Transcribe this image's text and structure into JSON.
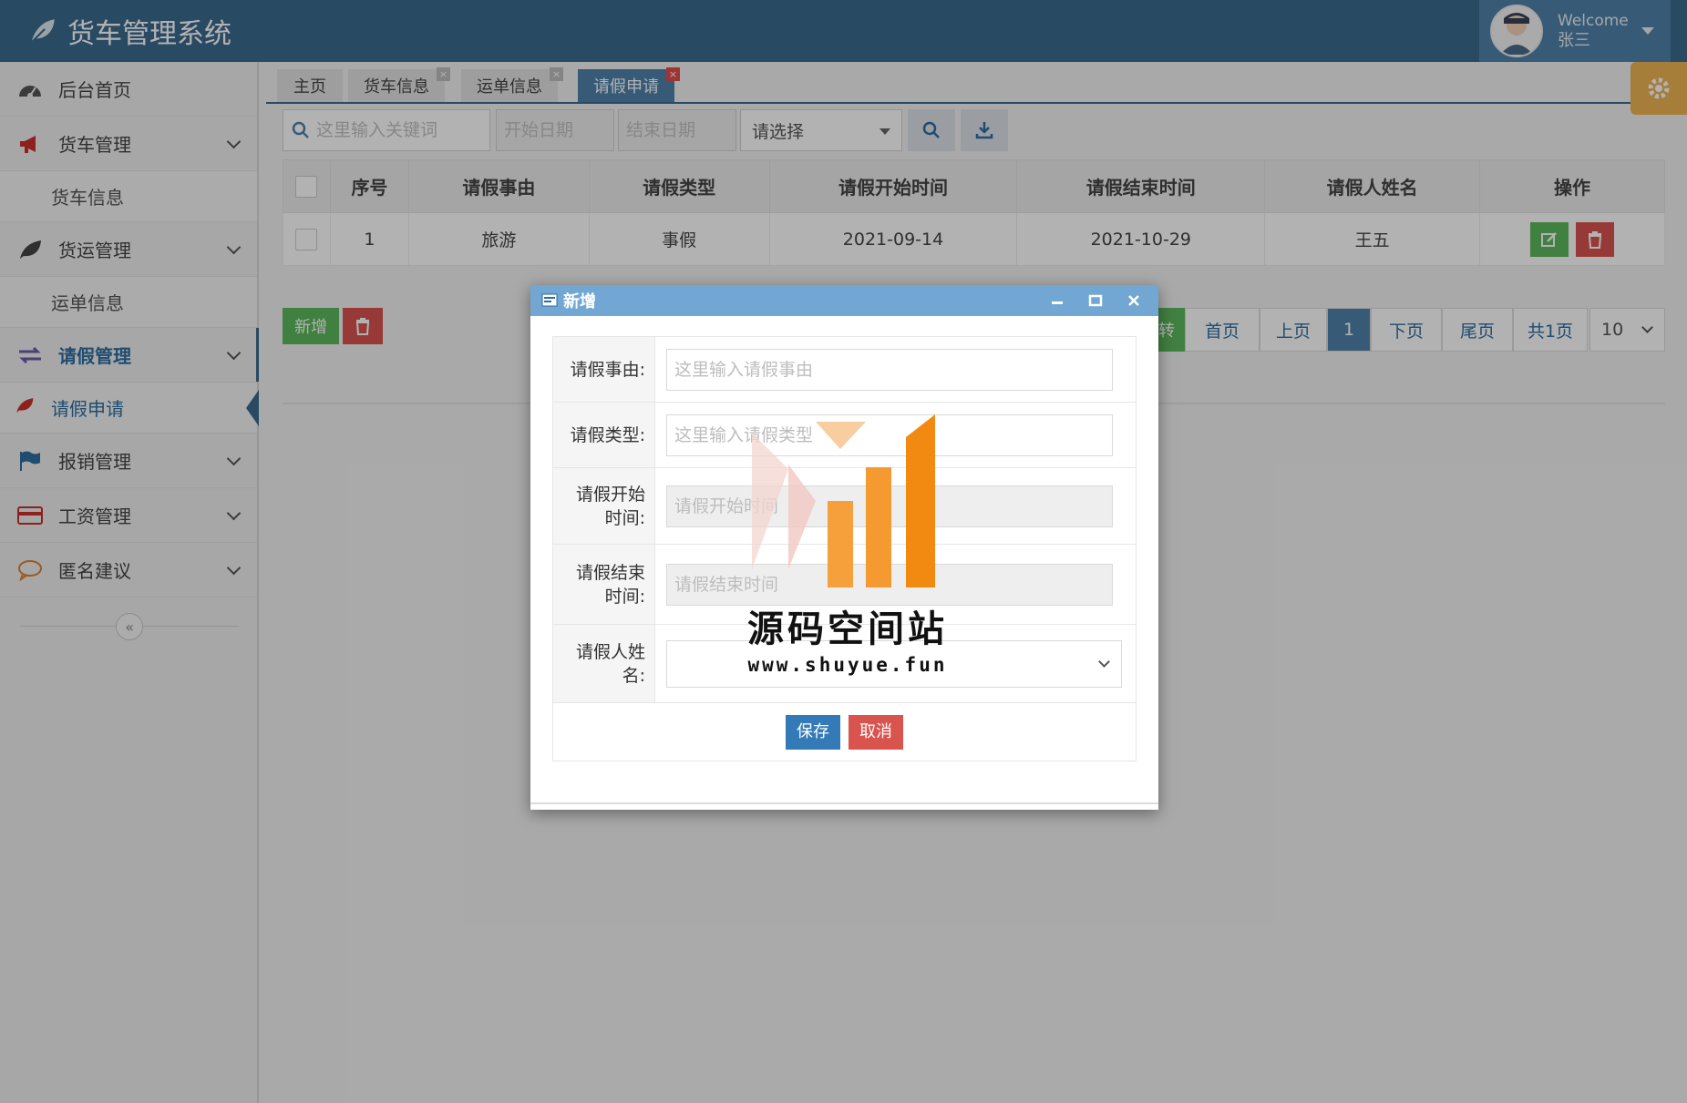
{
  "app": {
    "title": "货车管理系统"
  },
  "user": {
    "welcome": "Welcome",
    "name": "张三"
  },
  "sidebar": {
    "items": [
      {
        "label": "后台首页"
      },
      {
        "label": "货车管理"
      },
      {
        "label": "货车信息"
      },
      {
        "label": "货运管理"
      },
      {
        "label": "运单信息"
      },
      {
        "label": "请假管理"
      },
      {
        "label": "请假申请"
      },
      {
        "label": "报销管理"
      },
      {
        "label": "工资管理"
      },
      {
        "label": "匿名建议"
      }
    ],
    "collapse_glyph": "«"
  },
  "tabs": [
    {
      "label": "主页"
    },
    {
      "label": "货车信息"
    },
    {
      "label": "运单信息"
    },
    {
      "label": "请假申请"
    }
  ],
  "toolbar": {
    "search_placeholder": "这里输入关键词",
    "start_date_placeholder": "开始日期",
    "end_date_placeholder": "结束日期",
    "select_value": "请选择"
  },
  "table": {
    "headers": [
      "序号",
      "请假事由",
      "请假类型",
      "请假开始时间",
      "请假结束时间",
      "请假人姓名",
      "操作"
    ],
    "rows": [
      {
        "no": "1",
        "reason": "旅游",
        "type": "事假",
        "start": "2021-09-14",
        "end": "2021-10-29",
        "name": "王五"
      }
    ]
  },
  "actions": {
    "new_label": "新增"
  },
  "pagination": {
    "go": "转",
    "first": "首页",
    "prev": "上页",
    "current": "1",
    "next": "下页",
    "last": "尾页",
    "total": "共1页",
    "page_size": "10"
  },
  "dialog": {
    "title": "新增",
    "fields": {
      "reason_label": "请假事由:",
      "reason_placeholder": "这里输入请假事由",
      "type_label": "请假类型:",
      "type_placeholder": "这里输入请假类型",
      "start_label_1": "请假开始",
      "start_label_2": "时间:",
      "start_placeholder": "请假开始时间",
      "end_label_1": "请假结束",
      "end_label_2": "时间:",
      "end_placeholder": "请假结束时间",
      "name_label_1": "请假人姓",
      "name_label_2": "名:"
    },
    "save": "保存",
    "cancel": "取消"
  },
  "watermark": {
    "line1": "源码空间站",
    "line2": "www.shuyue.fun"
  },
  "colors": {
    "header": "#3c6a8e",
    "accent": "#4f83aa",
    "success": "#5cb85c",
    "danger": "#d9534f",
    "primary": "#337ab7",
    "dialog_title": "#71a7d2",
    "warning": "#f0b454"
  }
}
